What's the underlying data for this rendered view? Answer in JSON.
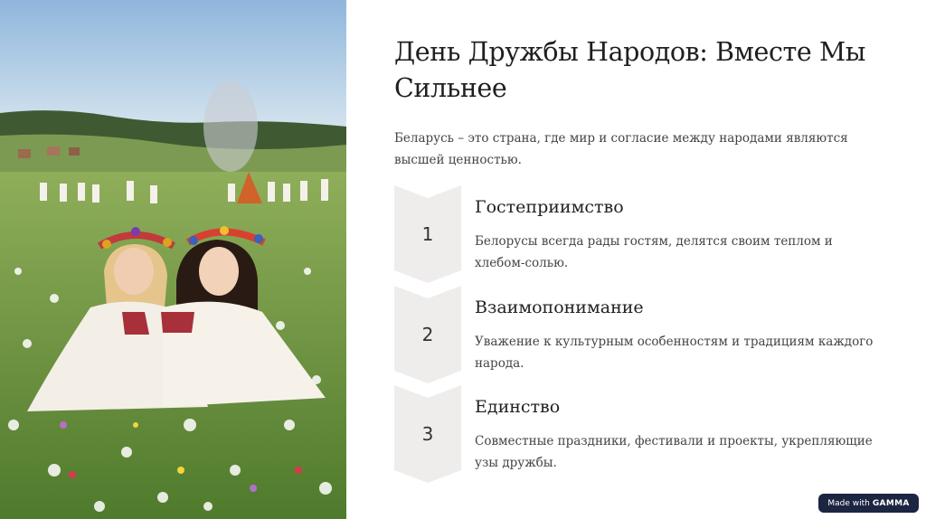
{
  "slide": {
    "title": "День Дружбы Народов: Вместе Мы Сильнее",
    "intro": "Беларусь – это страна, где мир и согласие между народами являются высшей ценностью."
  },
  "steps": [
    {
      "number": "1",
      "title": "Гостеприимство",
      "text": "Белорусы всегда рады гостям, делятся своим теплом и хлебом-солью."
    },
    {
      "number": "2",
      "title": "Взаимопонимание",
      "text": "Уважение к культурным особенностям и традициям каждого народа."
    },
    {
      "number": "3",
      "title": "Единство",
      "text": "Совместные праздники, фестивали и проекты, укрепляющие узы дружбы."
    }
  ],
  "badge": {
    "prefix": "Made with",
    "brand": "GAMMA"
  },
  "colors": {
    "chevron": "#efecec",
    "badge_bg": "#1c2541",
    "title": "#1f1f1f"
  }
}
